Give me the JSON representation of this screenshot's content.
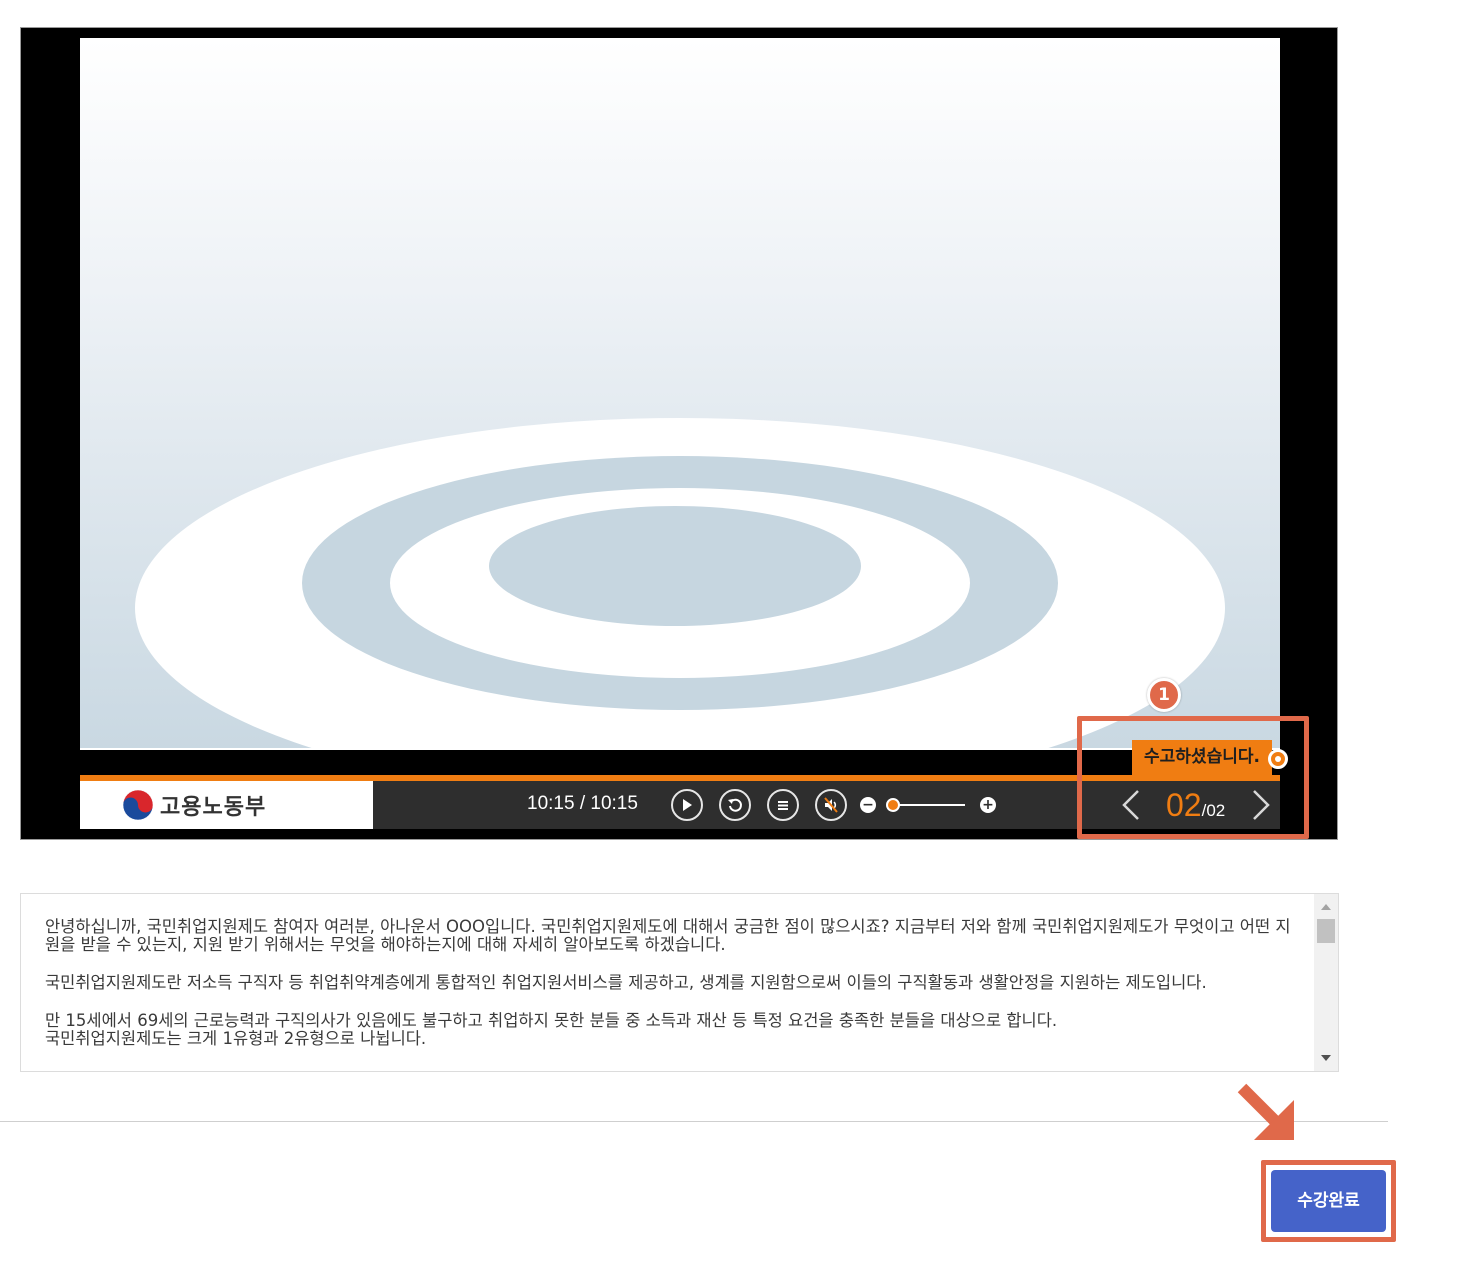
{
  "player": {
    "logo_text": "고용노동부",
    "time": "10:15 / 10:15",
    "page_current": "02",
    "page_total": "/02",
    "complete_label": "수고하셨습니다.",
    "progress_fraction": 1.0,
    "volume_fraction": 0.0,
    "accent_color": "#f07d12"
  },
  "annotation": {
    "marker_number": "1",
    "highlight_color": "#e0694a"
  },
  "script": {
    "paragraphs": [
      "안녕하십니까, 국민취업지원제도 참여자 여러분, 아나운서 OOO입니다. 국민취업지원제도에 대해서 궁금한 점이 많으시죠? 지금부터 저와 함께 국민취업지원제도가 무엇이고 어떤 지원을 받을 수 있는지, 지원 받기 위해서는 무엇을 해야하는지에 대해 자세히 알아보도록 하겠습니다.",
      "국민취업지원제도란 저소득 구직자 등 취업취약계층에게 통합적인 취업지원서비스를 제공하고, 생계를 지원함으로써 이들의 구직활동과 생활안정을 지원하는 제도입니다.",
      "만 15세에서 69세의 근로능력과 구직의사가 있음에도 불구하고 취업하지 못한 분들 중 소득과 재산 등 특정 요건을 충족한 분들을 대상으로 합니다.",
      "국민취업지원제도는 크게 1유형과 2유형으로 나뉩니다."
    ]
  },
  "buttons": {
    "complete": "수강완료"
  },
  "icons": {
    "play": "play-icon",
    "replay": "replay-icon",
    "menu": "menu-icon",
    "mute": "mute-icon",
    "prev": "chevron-left-icon",
    "next": "chevron-right-icon",
    "arrow": "arrow-down-right-icon"
  }
}
